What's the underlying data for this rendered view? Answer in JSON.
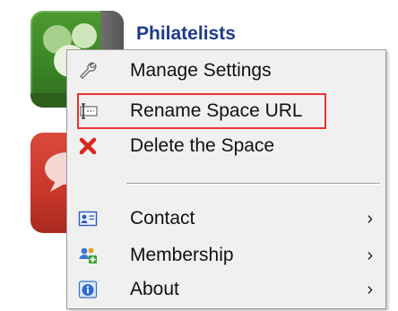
{
  "space": {
    "title": "Philatelists"
  },
  "menu": {
    "items": [
      {
        "label": "Manage Settings",
        "icon": "wrench-icon",
        "submenu": false
      },
      {
        "label": "Rename Space URL",
        "icon": "rename-icon",
        "submenu": false,
        "highlighted": true
      },
      {
        "label": "Delete the Space",
        "icon": "delete-x-icon",
        "submenu": false
      },
      {
        "label": "Contact",
        "icon": "contact-card-icon",
        "submenu": true
      },
      {
        "label": "Membership",
        "icon": "membership-icon",
        "submenu": true
      },
      {
        "label": "About",
        "icon": "info-icon",
        "submenu": true
      }
    ],
    "submenu_indicator": "›"
  },
  "colors": {
    "title": "#1e3a8c",
    "highlight_border": "#e63333",
    "menu_background": "#f0f0f0"
  }
}
